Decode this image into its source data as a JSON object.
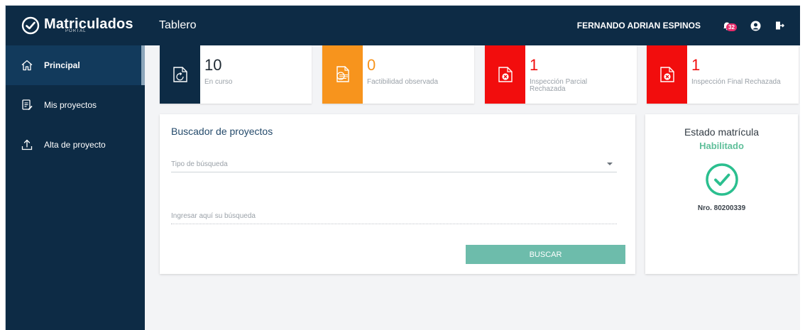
{
  "app": {
    "logo_text": "Matriculados",
    "logo_sub": "PORTAL"
  },
  "sidebar": {
    "items": [
      {
        "label": "Principal",
        "icon": "home-icon",
        "active": true
      },
      {
        "label": "Mis proyectos",
        "icon": "document-edit-icon",
        "active": false
      },
      {
        "label": "Alta de proyecto",
        "icon": "upload-icon",
        "active": false
      }
    ]
  },
  "topbar": {
    "title": "Tablero",
    "user_name": "FERNANDO ADRIAN ESPINOS",
    "notification_count": "32"
  },
  "cards": [
    {
      "number": "10",
      "label": "En curso",
      "color": "#0d2b45",
      "number_color": "#1f2a33",
      "icon": "refresh-document-icon"
    },
    {
      "number": "0",
      "label": "Factibilidad observada",
      "color": "#f7941d",
      "number_color": "#f7941d",
      "icon": "document-search-icon"
    },
    {
      "number": "1",
      "label": "Inspección Parcial Rechazada",
      "color": "#f20d0d",
      "number_color": "#f20d0d",
      "icon": "document-reject-icon"
    },
    {
      "number": "1",
      "label": "Inspección Final Rechazada",
      "color": "#f20d0d",
      "number_color": "#f20d0d",
      "icon": "document-reject-icon"
    }
  ],
  "search": {
    "title": "Buscador de proyectos",
    "type_placeholder": "Tipo de búsqueda",
    "input_placeholder": "Ingresar aquí su búsqueda",
    "button_label": "BUSCAR"
  },
  "status": {
    "title": "Estado matrícula",
    "value": "Habilitado",
    "number": "Nro. 80200339"
  }
}
